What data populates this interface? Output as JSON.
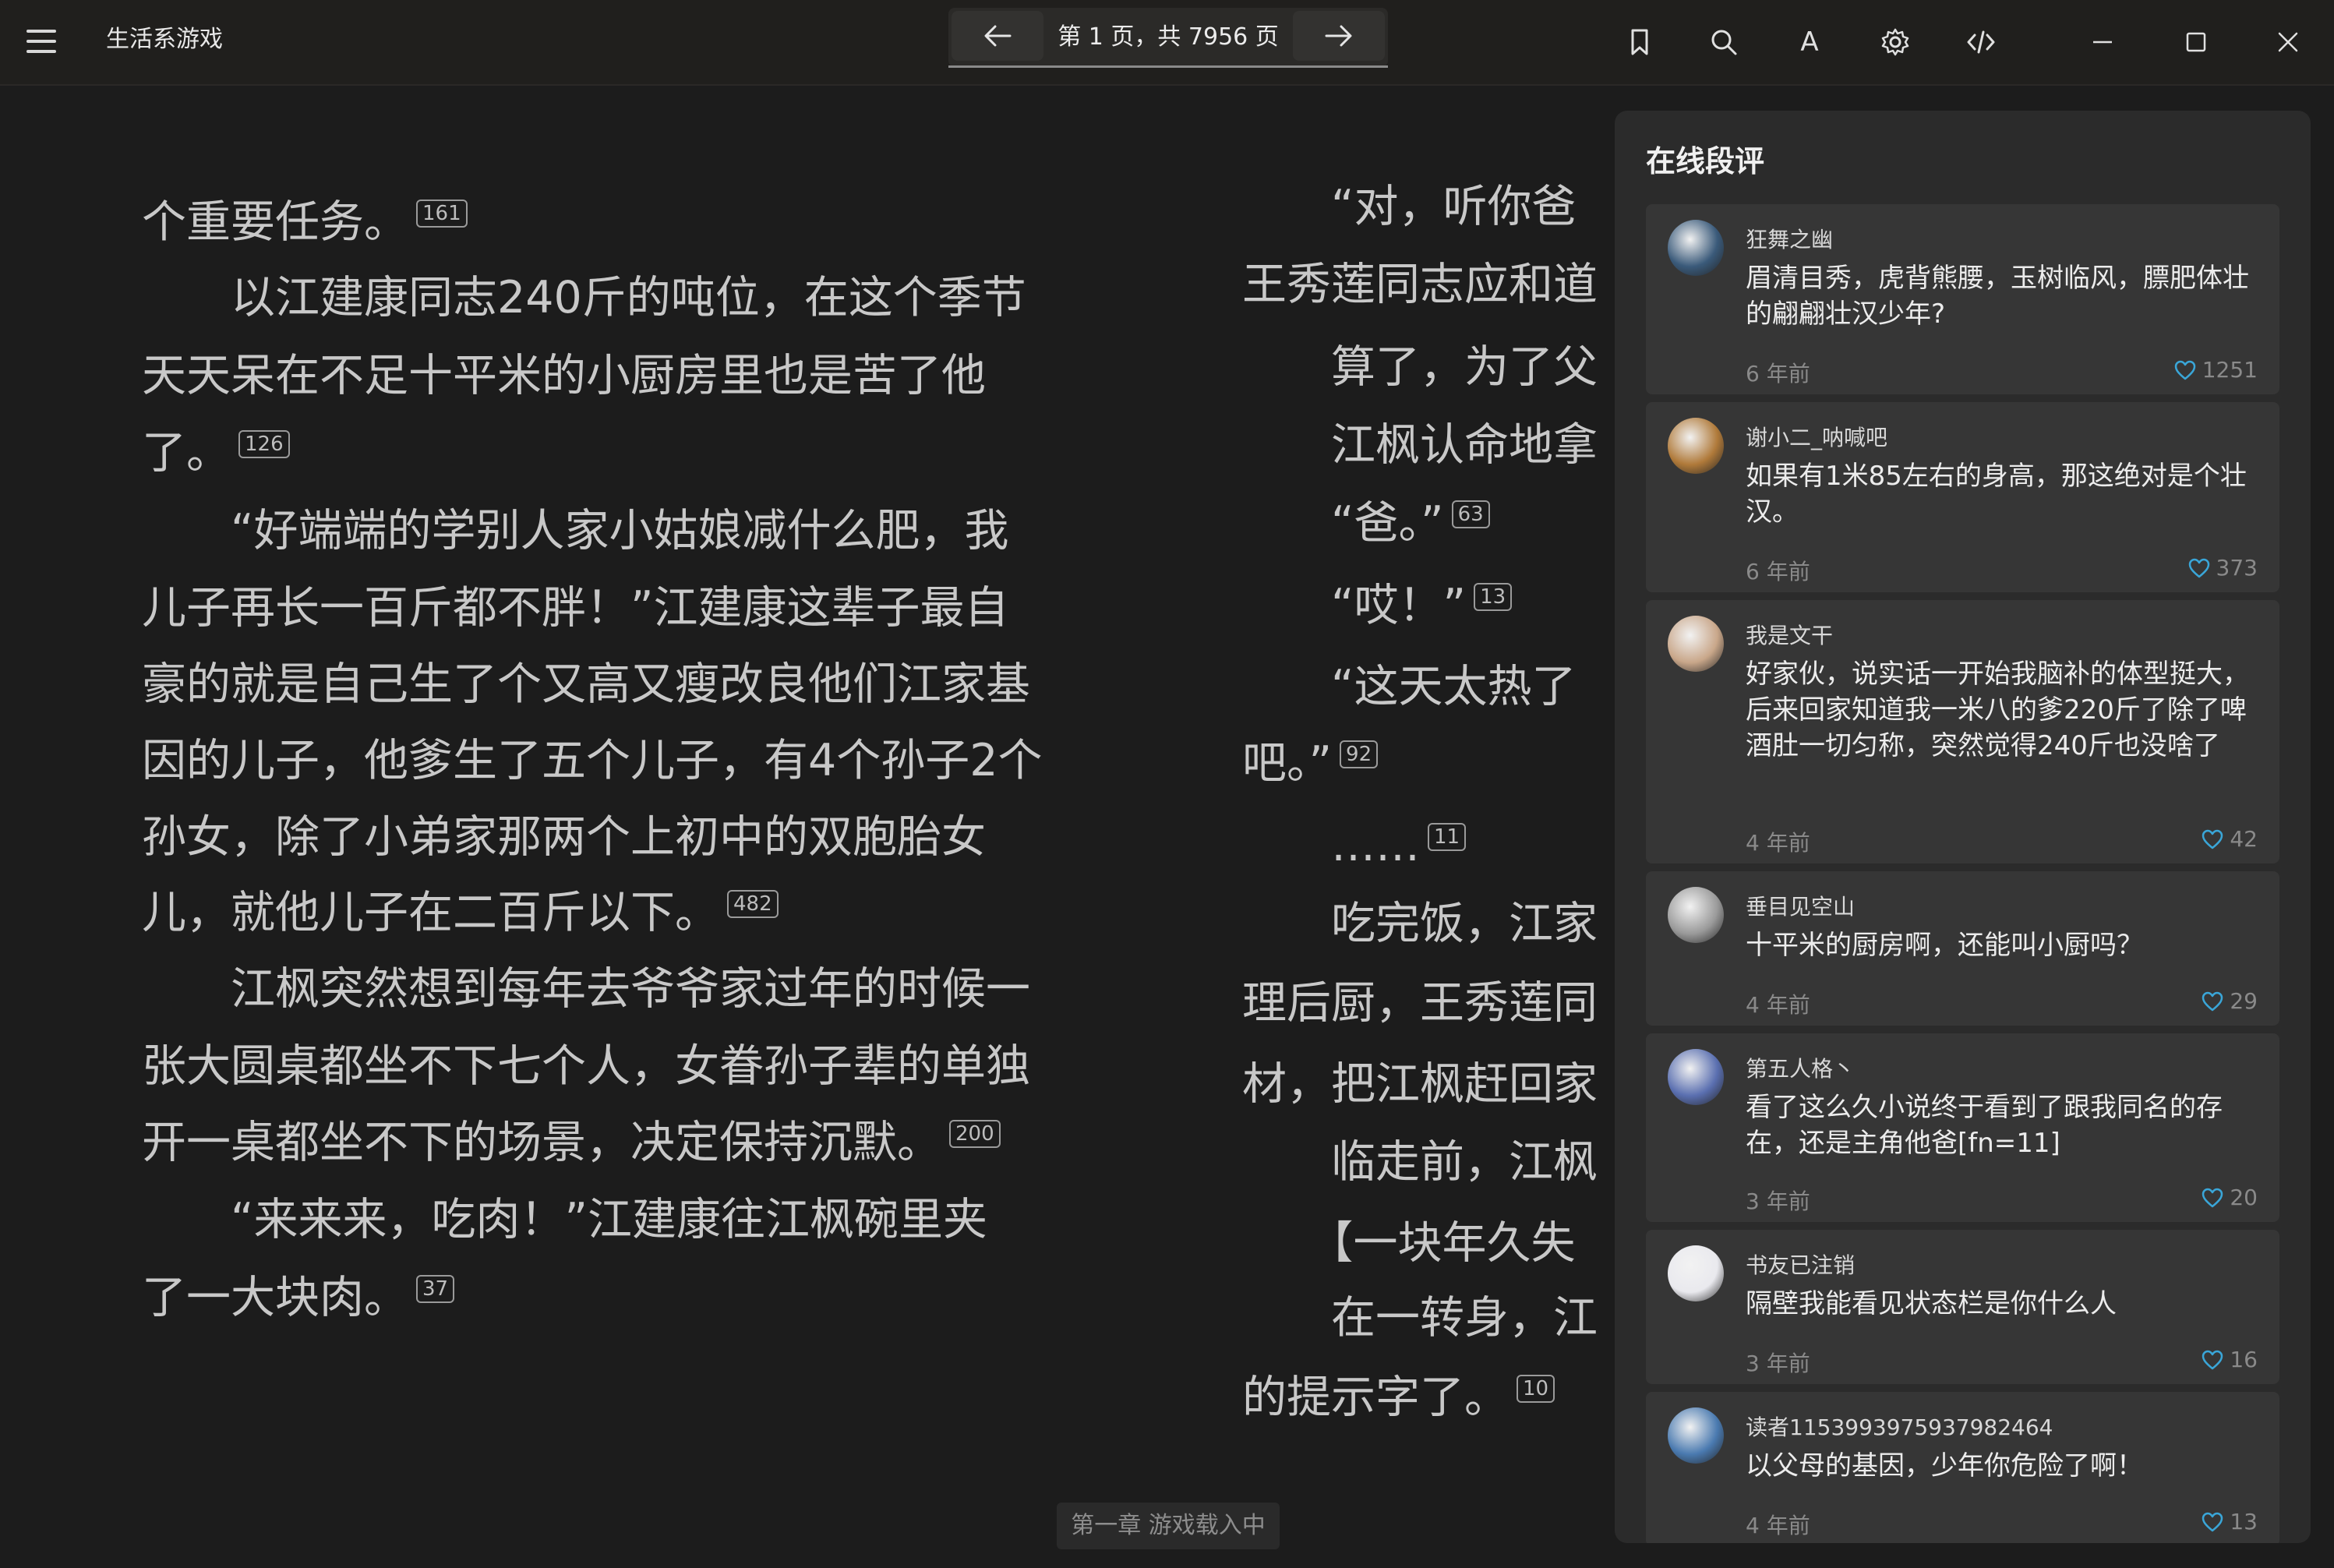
{
  "app": {
    "title": "生活系游戏",
    "page_indicator": "第 1 页，共 7956 页"
  },
  "toolbar": {
    "font_icon_glyph": "A"
  },
  "left_column": [
    {
      "text": "个重要任务。",
      "fn": "161"
    },
    {
      "text": "　　以江建康同志240斤的吨位，在这个季节",
      "fn": null
    },
    {
      "text": "天天呆在不足十平米的小厨房里也是苦了他",
      "fn": null
    },
    {
      "text": "了。",
      "fn": "126"
    },
    {
      "text": "　　“好端端的学别人家小姑娘减什么肥，我",
      "fn": null
    },
    {
      "text": "儿子再长一百斤都不胖！”江建康这辈子最自",
      "fn": null
    },
    {
      "text": "豪的就是自己生了个又高又瘦改良他们江家基",
      "fn": null
    },
    {
      "text": "因的儿子，他爹生了五个儿子，有4个孙子2个",
      "fn": null
    },
    {
      "text": "孙女，除了小弟家那两个上初中的双胞胎女",
      "fn": null
    },
    {
      "text": "儿，就他儿子在二百斤以下。",
      "fn": "482"
    },
    {
      "text": "　　江枫突然想到每年去爷爷家过年的时候一",
      "fn": null
    },
    {
      "text": "张大圆桌都坐不下七个人，女眷孙子辈的单独",
      "fn": null
    },
    {
      "text": "开一桌都坐不下的场景，决定保持沉默。",
      "fn": "200"
    },
    {
      "text": "　　“来来来，吃肉！”江建康往江枫碗里夹",
      "fn": null
    },
    {
      "text": "了一大块肉。",
      "fn": "37"
    }
  ],
  "right_column": [
    {
      "text": "　　“对，听你爸",
      "fn": null
    },
    {
      "text": "王秀莲同志应和道",
      "fn": null
    },
    {
      "text": "　　算了，为了父",
      "fn": null
    },
    {
      "text": "　　江枫认命地拿",
      "fn": null
    },
    {
      "text": "　　“爸。”",
      "fn": "63"
    },
    {
      "text": "　　“哎！”",
      "fn": "13"
    },
    {
      "text": "　　“这天太热了",
      "fn": null
    },
    {
      "text": "吧。”",
      "fn": "92"
    },
    {
      "text": "　　……",
      "fn": "11"
    },
    {
      "text": "　　吃完饭，江家",
      "fn": null
    },
    {
      "text": "理后厨，王秀莲同",
      "fn": null
    },
    {
      "text": "材，把江枫赶回家",
      "fn": null
    },
    {
      "text": "　　临走前，江枫",
      "fn": null
    },
    {
      "text": "　　【一块年久失",
      "fn": null
    },
    {
      "text": "　　在一转身，江",
      "fn": null
    },
    {
      "text": "的提示字了。",
      "fn": "10"
    }
  ],
  "chapter_label": "第一章 游戏载入中",
  "comments": {
    "title": "在线段评",
    "items": [
      {
        "user": "狂舞之幽",
        "text": "眉清目秀，虎背熊腰，玉树临风，膘肥体壮的翩翩壮汉少年?",
        "time": "6 年前",
        "likes": "1251",
        "avatar_color": "#3a5a7a"
      },
      {
        "user": "谢小二_呐喊吧",
        "text": "如果有1米85左右的身高，那这绝对是个壮汉。",
        "time": "6 年前",
        "likes": "373",
        "avatar_color": "#b07a3a"
      },
      {
        "user": "我是文干",
        "text": "好家伙，说实话一开始我脑补的体型挺大，后来回家知道我一米八的爹220斤了除了啤酒肚一切匀称，突然觉得240斤也没啥了",
        "time": "4 年前",
        "likes": "42",
        "avatar_color": "#c9a78a"
      },
      {
        "user": "垂目见空山",
        "text": "十平米的厨房啊，还能叫小厨吗？",
        "time": "4 年前",
        "likes": "29",
        "avatar_color": "#9a9a9a"
      },
      {
        "user": "第五人格丶",
        "text": "看了这么久小说终于看到了跟我同名的存在，还是主角他爸[fn=11]",
        "time": "3 年前",
        "likes": "20",
        "avatar_color": "#5a6fb0"
      },
      {
        "user": "书友已注销",
        "text": "隔壁我能看见状态栏是你什么人",
        "time": "3 年前",
        "likes": "16",
        "avatar_color": "#e9e9ee"
      },
      {
        "user": "读者1153993975937982464",
        "text": "以父母的基因，少年你危险了啊！",
        "time": "4 年前",
        "likes": "13",
        "avatar_color": "#4a7ab0"
      }
    ]
  }
}
